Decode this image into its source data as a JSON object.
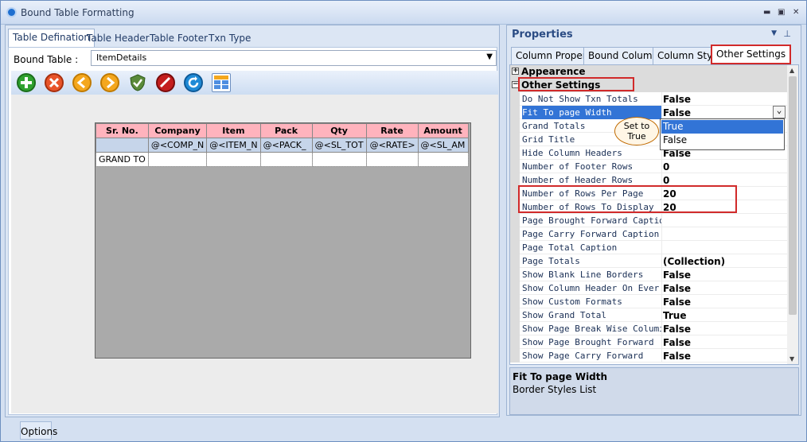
{
  "window": {
    "title": "Bound Table Formatting"
  },
  "left_tabs": [
    "Table Defination",
    "Table Header",
    "Table Footer",
    "Txn Type"
  ],
  "bound_table": {
    "label": "Bound Table :",
    "value": "ItemDetails"
  },
  "grid": {
    "headers": [
      "Sr. No.",
      "Company",
      "Item",
      "Pack",
      "Qty",
      "Rate",
      "Amount"
    ],
    "bind_row": [
      "",
      "@<COMP_N",
      "@<ITEM_N",
      "@<PACK_",
      "@<SL_TOT",
      "@<RATE>",
      "@<SL_AM"
    ],
    "grand_row": [
      "GRAND TO",
      "",
      "",
      "",
      "",
      "",
      ""
    ]
  },
  "properties": {
    "title": "Properties",
    "tabs": [
      "Column Property",
      "Bound Columns",
      "Column Style",
      "Other Settings"
    ],
    "categories": {
      "appearance": "Appearence",
      "other": "Other Settings"
    },
    "rows": [
      {
        "name": "Do Not Show Txn Totals",
        "value": "False"
      },
      {
        "name": "Fit To page Width",
        "value": "False"
      },
      {
        "name": "Grand Totals",
        "value": ""
      },
      {
        "name": "Grid Title",
        "value": ""
      },
      {
        "name": "Hide Column Headers",
        "value": "False"
      },
      {
        "name": "Number of Footer Rows",
        "value": "0"
      },
      {
        "name": "Number of Header Rows",
        "value": "0"
      },
      {
        "name": "Number of Rows Per Page",
        "value": "20"
      },
      {
        "name": "Number of Rows To Display",
        "value": "20"
      },
      {
        "name": "Page Brought Forward Caption",
        "value": ""
      },
      {
        "name": "Page Carry Forward Caption",
        "value": ""
      },
      {
        "name": "Page Total Caption",
        "value": ""
      },
      {
        "name": "Page Totals",
        "value": "(Collection)"
      },
      {
        "name": "Show Blank Line Borders",
        "value": "False"
      },
      {
        "name": "Show Column Header On Ever",
        "value": "False"
      },
      {
        "name": "Show Custom Formats",
        "value": "False"
      },
      {
        "name": "Show Grand Total",
        "value": "True"
      },
      {
        "name": "Show Page Break Wise Columi",
        "value": "False"
      },
      {
        "name": "Show Page Brought Forward",
        "value": "False"
      },
      {
        "name": "Show Page Carry Forward",
        "value": "False"
      }
    ],
    "dropdown_options": [
      "True",
      "False"
    ],
    "callout": {
      "line1": "Set to",
      "line2": "True"
    },
    "description": {
      "title": "Fit To page Width",
      "text": "Border Styles List"
    }
  },
  "status": {
    "options_label": "Options"
  },
  "colors": {
    "accent": "#3274d6",
    "highlight": "#d12a2a",
    "header_pink": "#ffb3bd"
  }
}
